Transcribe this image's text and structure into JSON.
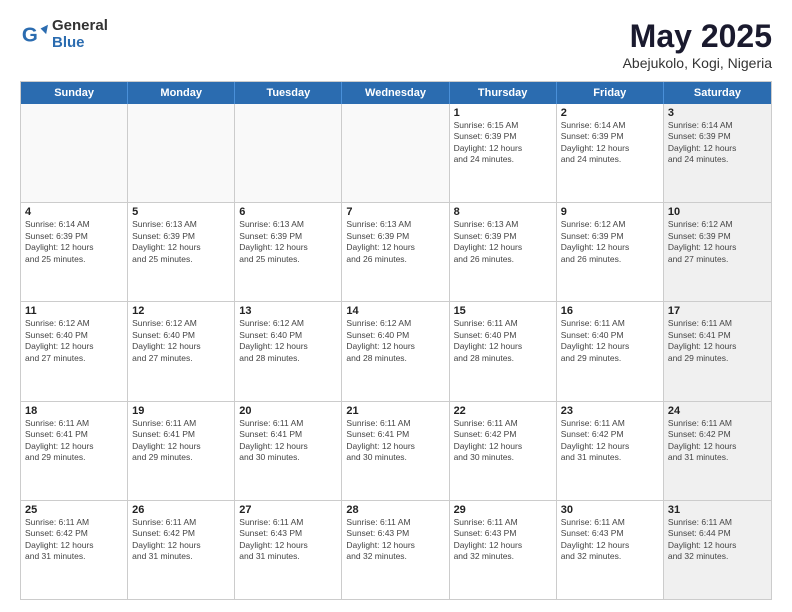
{
  "logo": {
    "general": "General",
    "blue": "Blue"
  },
  "title": "May 2025",
  "location": "Abejukolo, Kogi, Nigeria",
  "days": [
    "Sunday",
    "Monday",
    "Tuesday",
    "Wednesday",
    "Thursday",
    "Friday",
    "Saturday"
  ],
  "weeks": [
    [
      {
        "day": "",
        "info": "",
        "empty": true
      },
      {
        "day": "",
        "info": "",
        "empty": true
      },
      {
        "day": "",
        "info": "",
        "empty": true
      },
      {
        "day": "",
        "info": "",
        "empty": true
      },
      {
        "day": "1",
        "info": "Sunrise: 6:15 AM\nSunset: 6:39 PM\nDaylight: 12 hours\nand 24 minutes.",
        "empty": false
      },
      {
        "day": "2",
        "info": "Sunrise: 6:14 AM\nSunset: 6:39 PM\nDaylight: 12 hours\nand 24 minutes.",
        "empty": false
      },
      {
        "day": "3",
        "info": "Sunrise: 6:14 AM\nSunset: 6:39 PM\nDaylight: 12 hours\nand 24 minutes.",
        "empty": false,
        "shaded": true
      }
    ],
    [
      {
        "day": "4",
        "info": "Sunrise: 6:14 AM\nSunset: 6:39 PM\nDaylight: 12 hours\nand 25 minutes.",
        "empty": false
      },
      {
        "day": "5",
        "info": "Sunrise: 6:13 AM\nSunset: 6:39 PM\nDaylight: 12 hours\nand 25 minutes.",
        "empty": false
      },
      {
        "day": "6",
        "info": "Sunrise: 6:13 AM\nSunset: 6:39 PM\nDaylight: 12 hours\nand 25 minutes.",
        "empty": false
      },
      {
        "day": "7",
        "info": "Sunrise: 6:13 AM\nSunset: 6:39 PM\nDaylight: 12 hours\nand 26 minutes.",
        "empty": false
      },
      {
        "day": "8",
        "info": "Sunrise: 6:13 AM\nSunset: 6:39 PM\nDaylight: 12 hours\nand 26 minutes.",
        "empty": false
      },
      {
        "day": "9",
        "info": "Sunrise: 6:12 AM\nSunset: 6:39 PM\nDaylight: 12 hours\nand 26 minutes.",
        "empty": false
      },
      {
        "day": "10",
        "info": "Sunrise: 6:12 AM\nSunset: 6:39 PM\nDaylight: 12 hours\nand 27 minutes.",
        "empty": false,
        "shaded": true
      }
    ],
    [
      {
        "day": "11",
        "info": "Sunrise: 6:12 AM\nSunset: 6:40 PM\nDaylight: 12 hours\nand 27 minutes.",
        "empty": false
      },
      {
        "day": "12",
        "info": "Sunrise: 6:12 AM\nSunset: 6:40 PM\nDaylight: 12 hours\nand 27 minutes.",
        "empty": false
      },
      {
        "day": "13",
        "info": "Sunrise: 6:12 AM\nSunset: 6:40 PM\nDaylight: 12 hours\nand 28 minutes.",
        "empty": false
      },
      {
        "day": "14",
        "info": "Sunrise: 6:12 AM\nSunset: 6:40 PM\nDaylight: 12 hours\nand 28 minutes.",
        "empty": false
      },
      {
        "day": "15",
        "info": "Sunrise: 6:11 AM\nSunset: 6:40 PM\nDaylight: 12 hours\nand 28 minutes.",
        "empty": false
      },
      {
        "day": "16",
        "info": "Sunrise: 6:11 AM\nSunset: 6:40 PM\nDaylight: 12 hours\nand 29 minutes.",
        "empty": false
      },
      {
        "day": "17",
        "info": "Sunrise: 6:11 AM\nSunset: 6:41 PM\nDaylight: 12 hours\nand 29 minutes.",
        "empty": false,
        "shaded": true
      }
    ],
    [
      {
        "day": "18",
        "info": "Sunrise: 6:11 AM\nSunset: 6:41 PM\nDaylight: 12 hours\nand 29 minutes.",
        "empty": false
      },
      {
        "day": "19",
        "info": "Sunrise: 6:11 AM\nSunset: 6:41 PM\nDaylight: 12 hours\nand 29 minutes.",
        "empty": false
      },
      {
        "day": "20",
        "info": "Sunrise: 6:11 AM\nSunset: 6:41 PM\nDaylight: 12 hours\nand 30 minutes.",
        "empty": false
      },
      {
        "day": "21",
        "info": "Sunrise: 6:11 AM\nSunset: 6:41 PM\nDaylight: 12 hours\nand 30 minutes.",
        "empty": false
      },
      {
        "day": "22",
        "info": "Sunrise: 6:11 AM\nSunset: 6:42 PM\nDaylight: 12 hours\nand 30 minutes.",
        "empty": false
      },
      {
        "day": "23",
        "info": "Sunrise: 6:11 AM\nSunset: 6:42 PM\nDaylight: 12 hours\nand 31 minutes.",
        "empty": false
      },
      {
        "day": "24",
        "info": "Sunrise: 6:11 AM\nSunset: 6:42 PM\nDaylight: 12 hours\nand 31 minutes.",
        "empty": false,
        "shaded": true
      }
    ],
    [
      {
        "day": "25",
        "info": "Sunrise: 6:11 AM\nSunset: 6:42 PM\nDaylight: 12 hours\nand 31 minutes.",
        "empty": false
      },
      {
        "day": "26",
        "info": "Sunrise: 6:11 AM\nSunset: 6:42 PM\nDaylight: 12 hours\nand 31 minutes.",
        "empty": false
      },
      {
        "day": "27",
        "info": "Sunrise: 6:11 AM\nSunset: 6:43 PM\nDaylight: 12 hours\nand 31 minutes.",
        "empty": false
      },
      {
        "day": "28",
        "info": "Sunrise: 6:11 AM\nSunset: 6:43 PM\nDaylight: 12 hours\nand 32 minutes.",
        "empty": false
      },
      {
        "day": "29",
        "info": "Sunrise: 6:11 AM\nSunset: 6:43 PM\nDaylight: 12 hours\nand 32 minutes.",
        "empty": false
      },
      {
        "day": "30",
        "info": "Sunrise: 6:11 AM\nSunset: 6:43 PM\nDaylight: 12 hours\nand 32 minutes.",
        "empty": false
      },
      {
        "day": "31",
        "info": "Sunrise: 6:11 AM\nSunset: 6:44 PM\nDaylight: 12 hours\nand 32 minutes.",
        "empty": false,
        "shaded": true
      }
    ]
  ]
}
